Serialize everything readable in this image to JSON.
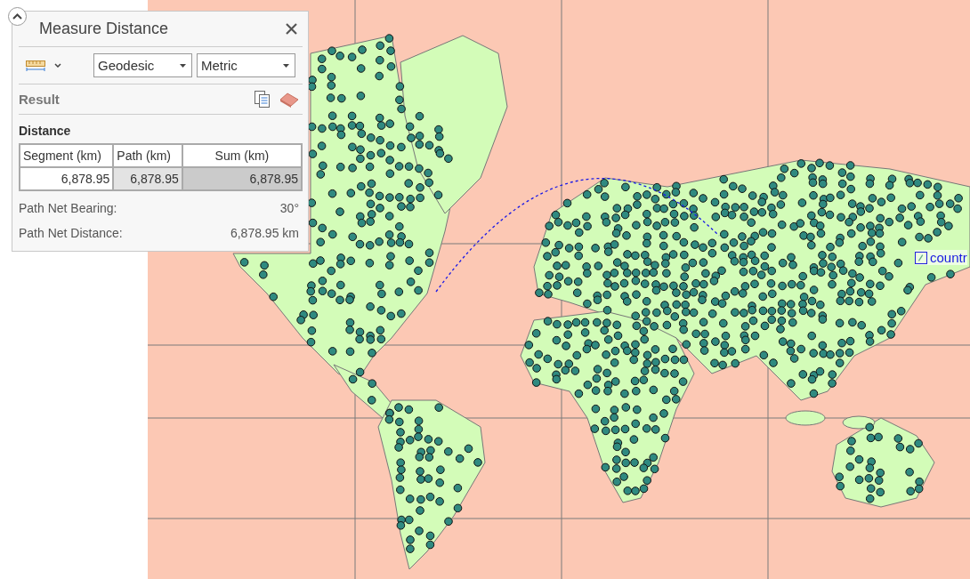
{
  "panel": {
    "title": "Measure Distance",
    "mode_select": {
      "value": "Geodesic"
    },
    "units_select": {
      "value": "Metric"
    },
    "result_label": "Result",
    "section_title": "Distance",
    "table": {
      "columns": [
        "Segment (km)",
        "Path (km)",
        "Sum (km)"
      ],
      "rows": [
        [
          "6,878.95",
          "6,878.95",
          "6,878.95"
        ]
      ]
    },
    "stats": [
      {
        "label": "Path Net Bearing:",
        "value": "30°"
      },
      {
        "label": "Path Net Distance:",
        "value": "6,878.95 km"
      }
    ]
  },
  "map": {
    "label": "countr"
  }
}
